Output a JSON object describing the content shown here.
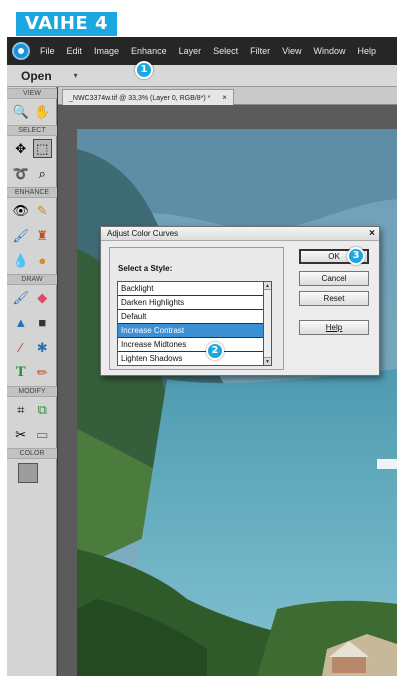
{
  "step_badge": "VAIHE 4",
  "menu": [
    "File",
    "Edit",
    "Image",
    "Enhance",
    "Layer",
    "Select",
    "Filter",
    "View",
    "Window",
    "Help"
  ],
  "options_bar": {
    "open_label": "Open",
    "dropdown_glyph": "▾"
  },
  "toolbox": {
    "sections": {
      "view": "VIEW",
      "select": "SELECT",
      "enhance": "ENHANCE",
      "draw": "DRAW",
      "modify": "MODIFY",
      "color": "COLOR"
    },
    "tools": {
      "zoom": "🔍",
      "hand": "✋",
      "move": "✥",
      "marquee": "⬚",
      "lasso": "➰",
      "quick-select": "⌕",
      "red-eye": "👁",
      "spot-healing": "✎",
      "smart-brush": "🖌",
      "clone-stamp": "♜",
      "blur": "💧",
      "sponge": "●",
      "brush": "🖌",
      "eraser": "◆",
      "paint-bucket": "▲",
      "gradient": "■",
      "color-picker": "⁄",
      "custom-shape": "✱",
      "type": "T",
      "pencil": "✏",
      "crop": "⌗",
      "recompose": "⧉",
      "content-move": "✂",
      "straighten": "▭"
    }
  },
  "document_tab": {
    "title": "_NWC3374w.tif @ 33,3% (Layer 0, RGB/8*) *",
    "close": "×"
  },
  "dialog": {
    "title": "Adjust Color Curves",
    "close": "×",
    "style_label": "Select a Style:",
    "styles": [
      "Backlight",
      "Darken Highlights",
      "Default",
      "Increase Contrast",
      "Increase Midtones",
      "Lighten Shadows"
    ],
    "selected_style": "Increase Contrast",
    "buttons": {
      "ok": "OK",
      "cancel": "Cancel",
      "reset": "Reset",
      "help": "Help"
    }
  },
  "callouts": [
    "1",
    "2",
    "3"
  ],
  "colors": {
    "accent": "#1ba7df",
    "menubar": "#262626",
    "selection": "#3b8fd4"
  }
}
